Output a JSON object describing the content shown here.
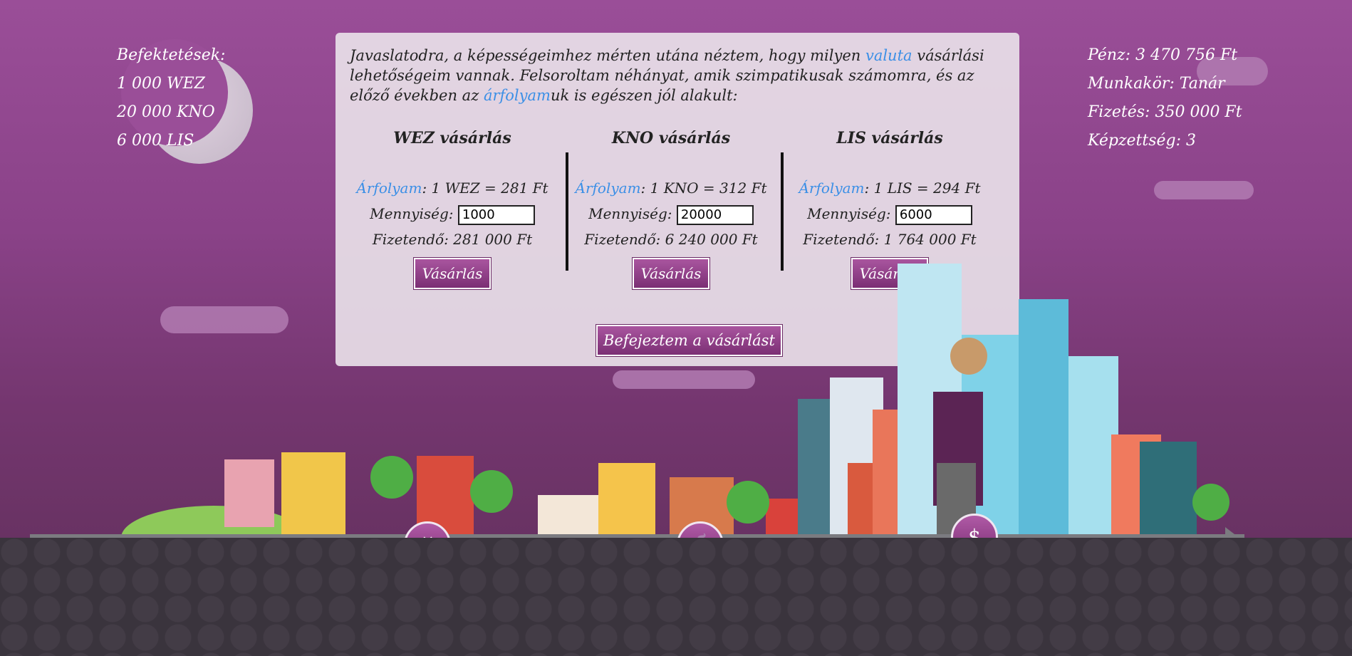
{
  "investments": {
    "title": "Befektetések:",
    "items": [
      "1 000 WEZ",
      "20 000 KNO",
      "6 000 LIS"
    ]
  },
  "status": {
    "money": "Pénz: 3 470 756 Ft",
    "job": "Munkakör: Tanár",
    "salary": "Fizetés: 350 000 Ft",
    "education": "Képzettség: 3"
  },
  "intro": {
    "part1": "Javaslatodra, a képességeimhez mérten utána néztem, hogy milyen ",
    "link1": "valuta",
    "part2": " vásárlási lehetőségeim vannak. Felsoroltam néhányat, amik szimpatikusak számomra, és az előző években az ",
    "link2": "árfolyam",
    "part3": "uk is egészen jól alakult:"
  },
  "currencies": [
    {
      "title": "WEZ vásárlás",
      "rate_label": "Árfolyam",
      "rate_value": ": 1 WEZ = 281 Ft",
      "qty_label": "Mennyiség:",
      "qty": "1000",
      "pay": "Fizetendő: 281 000 Ft",
      "button": "Vásárlás"
    },
    {
      "title": "KNO vásárlás",
      "rate_label": "Árfolyam",
      "rate_value": ": 1 KNO = 312 Ft",
      "qty_label": "Mennyiség:",
      "qty": "20000",
      "pay": "Fizetendő: 6 240 000 Ft",
      "button": "Vásárlás"
    },
    {
      "title": "LIS vásárlás",
      "rate_label": "Árfolyam",
      "rate_value": ": 1 LIS = 294 Ft",
      "qty_label": "Mennyiség:",
      "qty": "6000",
      "pay": "Fizetendő: 1 764 000 Ft",
      "button": "Vásárlás"
    }
  ],
  "finish_button": "Befejeztem a vásárlást",
  "milestones": [
    {
      "icon": "construction-icon",
      "glyph": "⚒"
    },
    {
      "icon": "coffee-laptop-icon",
      "glyph": "☕"
    },
    {
      "icon": "coins-icon",
      "glyph": "$"
    }
  ],
  "colors": {
    "link": "#3b8fe6",
    "button": "#8a3a82",
    "background": "#9a4e98"
  }
}
